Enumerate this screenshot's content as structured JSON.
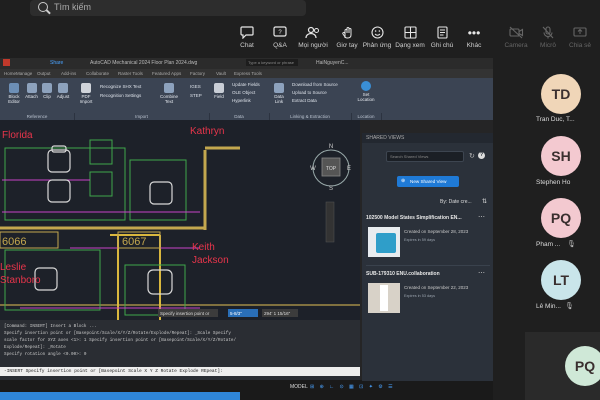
{
  "search": {
    "placeholder": "Tìm kiếm"
  },
  "toolbar": {
    "chat": "Chat",
    "qa": "Q&A",
    "people": "Mọi người",
    "raise": "Giơ tay",
    "react": "Phản ứng",
    "view": "Dạng xem",
    "notes": "Ghi chú",
    "more": "Khác",
    "camera": "Camera",
    "mic": "Micrô",
    "share": "Chia sẻ"
  },
  "autocad": {
    "title": "AutoCAD Mechanical 2024   Floor Plan 2024.dwg",
    "search_placeholder": "Type a keyword or phrase",
    "user": "HaiNguyenC...",
    "share_label": "Share",
    "tabs": [
      "Home",
      "Manage",
      "Output",
      "Add-ins",
      "Collaborate",
      "Raster Tools",
      "Featured Apps",
      "Factory",
      "Vault",
      "Express Tools"
    ],
    "ribbon": {
      "reference_btns": [
        "Attach",
        "Clip",
        "Adjust"
      ],
      "block_label": "Block Editor",
      "pdf_import": "PDF Import",
      "recognize_shx": "Recognize SHX Text",
      "recognition_settings": "Recognition Settings",
      "combine_text": "Combine Text",
      "iges": "IGES",
      "step": "STEP",
      "field": "Field",
      "update_fields": "Update Fields",
      "ole_object": "OLE Object",
      "hyperlink": "Hyperlink",
      "data_link": "Data Link",
      "download_source": "Download from Source",
      "upload_source": "Upload to Source",
      "extract_data": "Extract Data",
      "set_location": "Set Location",
      "groups": [
        "Reference",
        "Import",
        "Data",
        "Linking & Extraction",
        "Location"
      ]
    },
    "drawing": {
      "room_top_left": "Florida",
      "room_top_right": "Kathryn",
      "room_num_left": "6066",
      "room_num_mid": "6067",
      "name_mid_1": "Keith",
      "name_mid_2": "Jackson",
      "name_left_1": "Leslie",
      "name_left_2": "Stanboro",
      "insertion_prompt": "Specify insertion point or",
      "field_a": "5-8/3\"",
      "field_b": "294' 1 15/16\""
    },
    "command_history": [
      "[Command: INSERT]  Insert a Block ...",
      "Specify insertion point or [Basepoint/Scale/X/Y/Z/Rotate/Explode/Repeat]: _Scale Specify",
      "scale factor for XYZ axes <1>: 1 Specify insertion point or [Basepoint/Scale/X/Y/Z/Rotate/",
      "Explode/Repeat]: _Rotate",
      "Specify rotation angle <0.00>: 0"
    ],
    "command_line": "-INSERT Specify insertion point or [Basepoint Scale X Y Z Rotate Explode REpeat]:",
    "status_model": "MODEL"
  },
  "shared_views": {
    "header": "SHARED VIEWS",
    "search_placeholder": "Search Shared Views",
    "new_button": "New Shared View",
    "sort": "By: Date cre...",
    "cards": [
      {
        "title": "102500 Model States Simplification EN...",
        "line1": "Created on September 28, 2023",
        "line2": "Expires in 59 days"
      },
      {
        "title": "SUB-179310 ENU.collaboration",
        "line1": "Created on September 22, 2023",
        "line2": "Expires in 53 days"
      }
    ]
  },
  "participants": [
    {
      "initials": "TD",
      "name": "Tran Duc, T...",
      "color": "#f0d6b8"
    },
    {
      "initials": "SH",
      "name": "Stephen Ho",
      "color": "#f3c9d0"
    },
    {
      "initials": "PQ",
      "name": "Pham ...",
      "color": "#f3c9d0"
    },
    {
      "initials": "LT",
      "name": "Lê Min...",
      "color": "#c9e5ea"
    },
    {
      "initials": "PQ",
      "name": "",
      "color": "#cfe8d7"
    }
  ]
}
